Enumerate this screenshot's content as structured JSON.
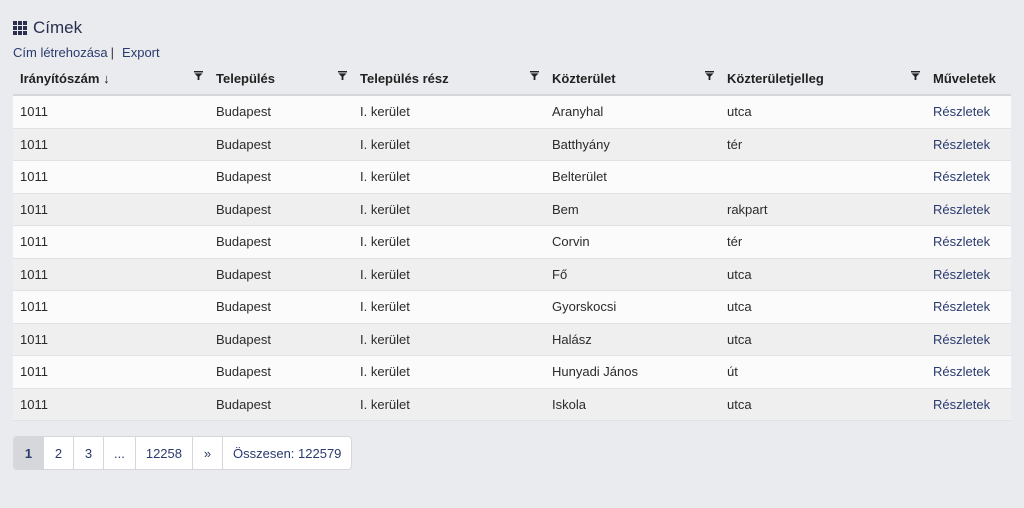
{
  "header": {
    "title": "Címek",
    "create_link": "Cím létrehozása",
    "separator": "|",
    "export_link": "Export"
  },
  "table": {
    "columns": [
      {
        "label": "Irányítószám ↓",
        "filter": true
      },
      {
        "label": "Település",
        "filter": true
      },
      {
        "label": "Település rész",
        "filter": true
      },
      {
        "label": "Közterület",
        "filter": true
      },
      {
        "label": "Közterületjelleg",
        "filter": true
      },
      {
        "label": "Műveletek",
        "filter": false
      }
    ],
    "rows": [
      [
        "1011",
        "Budapest",
        "I. kerület",
        "Aranyhal",
        "utca",
        "Részletek"
      ],
      [
        "1011",
        "Budapest",
        "I. kerület",
        "Batthyány",
        "tér",
        "Részletek"
      ],
      [
        "1011",
        "Budapest",
        "I. kerület",
        "Belterület",
        "",
        "Részletek"
      ],
      [
        "1011",
        "Budapest",
        "I. kerület",
        "Bem",
        "rakpart",
        "Részletek"
      ],
      [
        "1011",
        "Budapest",
        "I. kerület",
        "Corvin",
        "tér",
        "Részletek"
      ],
      [
        "1011",
        "Budapest",
        "I. kerület",
        "Fő",
        "utca",
        "Részletek"
      ],
      [
        "1011",
        "Budapest",
        "I. kerület",
        "Gyorskocsi",
        "utca",
        "Részletek"
      ],
      [
        "1011",
        "Budapest",
        "I. kerület",
        "Halász",
        "utca",
        "Részletek"
      ],
      [
        "1011",
        "Budapest",
        "I. kerület",
        "Hunyadi János",
        "út",
        "Részletek"
      ],
      [
        "1011",
        "Budapest",
        "I. kerület",
        "Iskola",
        "utca",
        "Részletek"
      ]
    ]
  },
  "pagination": {
    "pages": [
      "1",
      "2",
      "3",
      "...",
      "12258",
      "»"
    ],
    "active_index": 0,
    "total": "Összesen: 122579"
  }
}
